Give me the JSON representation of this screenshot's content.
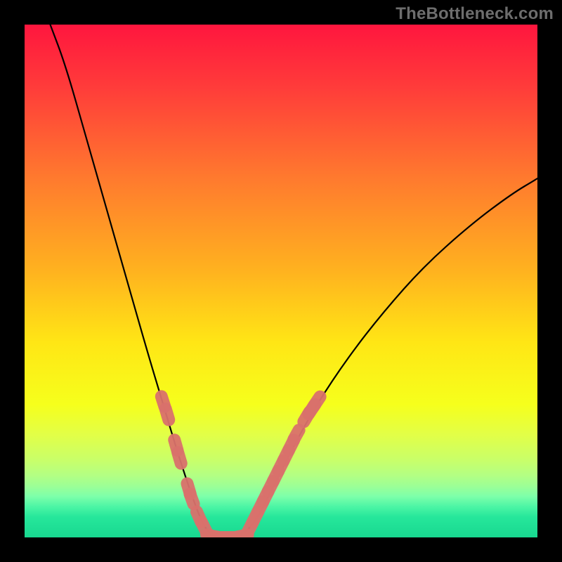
{
  "watermark": "TheBottleneck.com",
  "gradient": {
    "stops": [
      {
        "offset": "0%",
        "color": "#ff163e"
      },
      {
        "offset": "12%",
        "color": "#ff3b3a"
      },
      {
        "offset": "30%",
        "color": "#ff7a2e"
      },
      {
        "offset": "48%",
        "color": "#ffb21f"
      },
      {
        "offset": "62%",
        "color": "#ffe615"
      },
      {
        "offset": "74%",
        "color": "#f6ff1c"
      },
      {
        "offset": "80%",
        "color": "#e2ff47"
      },
      {
        "offset": "85%",
        "color": "#c8ff6a"
      },
      {
        "offset": "88%",
        "color": "#b2ff84"
      },
      {
        "offset": "90%",
        "color": "#9cff96"
      },
      {
        "offset": "92%",
        "color": "#7dffaa"
      },
      {
        "offset": "94%",
        "color": "#4cf5a5"
      },
      {
        "offset": "96%",
        "color": "#26e79b"
      },
      {
        "offset": "100%",
        "color": "#18d890"
      }
    ]
  },
  "chart_data": {
    "type": "line",
    "title": "",
    "xlabel": "",
    "ylabel": "",
    "xlim": [
      0,
      100
    ],
    "ylim": [
      0,
      100
    ],
    "curve_points": [
      {
        "x": 5,
        "y": 100
      },
      {
        "x": 8,
        "y": 92
      },
      {
        "x": 12,
        "y": 78
      },
      {
        "x": 16,
        "y": 64
      },
      {
        "x": 20,
        "y": 50
      },
      {
        "x": 24,
        "y": 36
      },
      {
        "x": 27,
        "y": 26
      },
      {
        "x": 30,
        "y": 16
      },
      {
        "x": 33,
        "y": 7
      },
      {
        "x": 35,
        "y": 2
      },
      {
        "x": 37,
        "y": 0
      },
      {
        "x": 40,
        "y": 0
      },
      {
        "x": 42,
        "y": 0
      },
      {
        "x": 45,
        "y": 3
      },
      {
        "x": 48,
        "y": 9
      },
      {
        "x": 52,
        "y": 17
      },
      {
        "x": 57,
        "y": 26
      },
      {
        "x": 63,
        "y": 35
      },
      {
        "x": 70,
        "y": 44
      },
      {
        "x": 78,
        "y": 53
      },
      {
        "x": 87,
        "y": 61
      },
      {
        "x": 95,
        "y": 67
      },
      {
        "x": 100,
        "y": 70
      }
    ],
    "marker_color": "#d9716c",
    "marker_radius_px": 9,
    "markers": {
      "left": [
        {
          "x": 27.0,
          "y": 26.5
        },
        {
          "x": 27.8,
          "y": 24.0
        },
        {
          "x": 29.5,
          "y": 18.0
        },
        {
          "x": 30.2,
          "y": 15.5
        },
        {
          "x": 32.0,
          "y": 9.5
        },
        {
          "x": 32.6,
          "y": 7.5
        },
        {
          "x": 34.0,
          "y": 4.0
        },
        {
          "x": 35.0,
          "y": 2.0
        }
      ],
      "bottom": [
        {
          "x": 36.5,
          "y": 0.3
        },
        {
          "x": 38.0,
          "y": 0.0
        },
        {
          "x": 39.5,
          "y": 0.0
        },
        {
          "x": 41.0,
          "y": 0.0
        },
        {
          "x": 42.5,
          "y": 0.3
        }
      ],
      "right": [
        {
          "x": 44.0,
          "y": 2.0
        },
        {
          "x": 45.0,
          "y": 4.0
        },
        {
          "x": 46.0,
          "y": 6.0
        },
        {
          "x": 47.0,
          "y": 8.0
        },
        {
          "x": 48.0,
          "y": 10.0
        },
        {
          "x": 49.0,
          "y": 12.0
        },
        {
          "x": 50.0,
          "y": 14.0
        },
        {
          "x": 51.0,
          "y": 16.0
        },
        {
          "x": 52.0,
          "y": 18.0
        },
        {
          "x": 53.0,
          "y": 20.0
        },
        {
          "x": 55.0,
          "y": 23.5
        },
        {
          "x": 56.0,
          "y": 25.0
        },
        {
          "x": 57.0,
          "y": 26.5
        }
      ]
    }
  }
}
